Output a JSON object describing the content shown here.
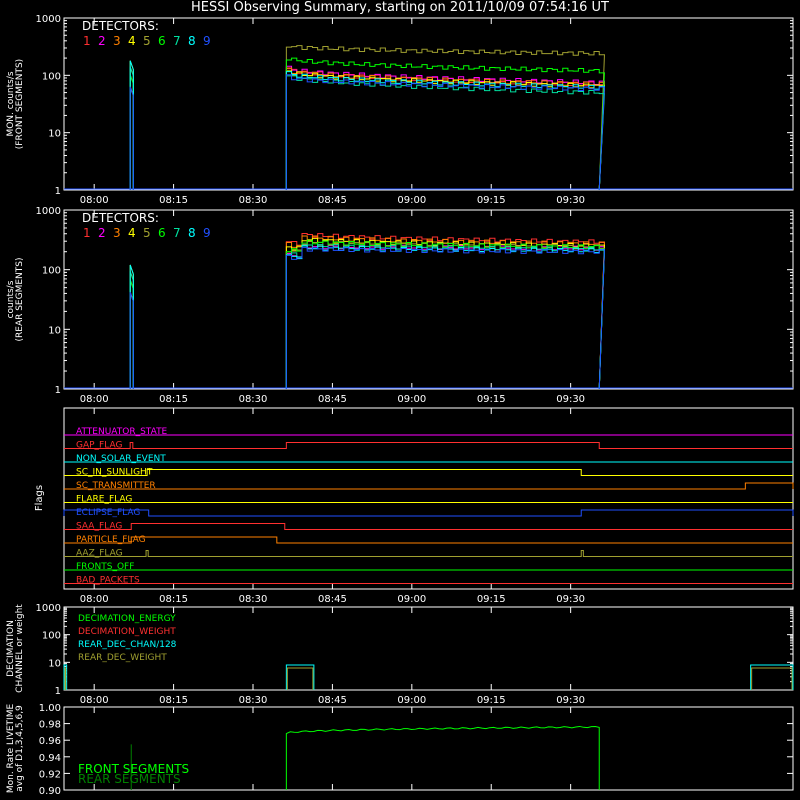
{
  "title": "HESSI Observing Summary, starting on 2011/10/09 07:54:16 UT",
  "colors": {
    "background": "#000000",
    "axes": "#ffffff",
    "det1": "#ff3030",
    "det2": "#ff00ff",
    "det3": "#ff8000",
    "det4": "#ffff00",
    "det5": "#a0a030",
    "det6": "#00ff00",
    "det7": "#00e0a0",
    "det8": "#00ffff",
    "det9": "#2050ff"
  },
  "time_ticks": [
    "08:00",
    "08:15",
    "08:30",
    "08:45",
    "09:00",
    "09:15",
    "09:30"
  ],
  "chart_data": [
    {
      "type": "line",
      "id": "front",
      "ylabel_lines": [
        "MON. counts/s",
        "(FRONT SEGMENTS)"
      ],
      "yscale": "log",
      "ylim": [
        1,
        1000
      ],
      "ytick_labels": [
        "1000",
        "100",
        "10",
        "1"
      ],
      "legend_title": "DETECTORS:",
      "legend_digits": [
        "1",
        "2",
        "3",
        "4",
        "5",
        "6",
        "7",
        "8",
        "9"
      ],
      "x_unit": "UT minutes since 08:00",
      "xlim": [
        -5.7,
        37.5
      ],
      "spike": {
        "start": 6.8,
        "end": 7.4,
        "peak": 180
      },
      "orbit": {
        "start": 36.3,
        "end": 95.4
      },
      "series": [
        {
          "name": "1",
          "color": "#ff3030",
          "start": 130,
          "end": 70
        },
        {
          "name": "2",
          "color": "#ff00ff",
          "start": 135,
          "end": 75
        },
        {
          "name": "3",
          "color": "#ff8000",
          "start": 125,
          "end": 70
        },
        {
          "name": "4",
          "color": "#ffff00",
          "start": 118,
          "end": 65
        },
        {
          "name": "5",
          "color": "#a0a030",
          "start": 330,
          "end": 240
        },
        {
          "name": "6",
          "color": "#00ff00",
          "start": 200,
          "end": 120
        },
        {
          "name": "7",
          "color": "#00e0a0",
          "start": 100,
          "end": 50
        },
        {
          "name": "8",
          "color": "#00ffff",
          "start": 110,
          "end": 62
        },
        {
          "name": "9",
          "color": "#2050ff",
          "start": 95,
          "end": 58
        }
      ]
    },
    {
      "type": "line",
      "id": "rear",
      "ylabel_lines": [
        "counts/s",
        "(REAR SEGMENTS)"
      ],
      "yscale": "log",
      "ylim": [
        1,
        1000
      ],
      "ytick_labels": [
        "1000",
        "100",
        "10",
        "1"
      ],
      "legend_title": "DETECTORS:",
      "legend_digits": [
        "1",
        "2",
        "3",
        "4",
        "5",
        "6",
        "7",
        "8",
        "9"
      ],
      "spike": {
        "start": 6.8,
        "end": 7.4,
        "peak": 120
      },
      "orbit": {
        "start": 36.3,
        "end": 95.4
      },
      "series": [
        {
          "name": "1",
          "color": "#ff3030",
          "start": 420,
          "end": 290
        },
        {
          "name": "2",
          "color": "#ff00ff",
          "start": 250,
          "end": 230
        },
        {
          "name": "3",
          "color": "#ff8000",
          "start": 380,
          "end": 270
        },
        {
          "name": "4",
          "color": "#ffff00",
          "start": 340,
          "end": 250
        },
        {
          "name": "5",
          "color": "#a0a030",
          "start": 300,
          "end": 240
        },
        {
          "name": "6",
          "color": "#00ff00",
          "start": 310,
          "end": 240
        },
        {
          "name": "7",
          "color": "#00e0a0",
          "start": 260,
          "end": 220
        },
        {
          "name": "8",
          "color": "#00ffff",
          "start": 240,
          "end": 210
        },
        {
          "name": "9",
          "color": "#2050ff",
          "start": 230,
          "end": 200
        }
      ]
    },
    {
      "type": "line",
      "id": "flags",
      "ylabel": "Flags",
      "flags": [
        {
          "name": "ATTENUATOR_STATE",
          "color": "#ff00ff",
          "segments": []
        },
        {
          "name": "GAP_FLAG",
          "color": "#ff3030",
          "segments": [
            [
              6.8,
              7.3
            ],
            [
              36.3,
              95.4
            ]
          ],
          "blips_only_first": true
        },
        {
          "name": "NON_SOLAR_EVENT",
          "color": "#00ffff",
          "segments": []
        },
        {
          "name": "SC_IN_SUNLIGHT",
          "color": "#ffff00",
          "segments": [
            [
              10.0,
              92.0
            ]
          ]
        },
        {
          "name": "SC_TRANSMITTER",
          "color": "#ff8000",
          "segments": [
            [
              123.0,
              137.0
            ]
          ]
        },
        {
          "name": "FLARE_FLAG",
          "color": "#ffff00",
          "segments": []
        },
        {
          "name": "ECLIPSE_FLAG",
          "color": "#2050ff",
          "segments": [
            [
              -5.7,
              10.3
            ],
            [
              92.0,
              137.0
            ]
          ]
        },
        {
          "name": "SAA_FLAG",
          "color": "#ff3030",
          "segments": [
            [
              7.0,
              36.0
            ]
          ]
        },
        {
          "name": "PARTICLE_FLAG",
          "color": "#ff8000",
          "segments": [
            [
              7.0,
              34.5
            ]
          ]
        },
        {
          "name": "AAZ_FLAG",
          "color": "#a0a030",
          "segments": [
            [
              9.8,
              10.2
            ],
            [
              92.0,
              92.4
            ]
          ]
        },
        {
          "name": "FRONTS_OFF",
          "color": "#00ff00",
          "segments": []
        },
        {
          "name": "BAD_PACKETS",
          "color": "#ff3030",
          "segments": []
        }
      ]
    },
    {
      "type": "line",
      "id": "decimation",
      "ylabel_lines": [
        "DECIMATION",
        "CHANNEL or weight"
      ],
      "yscale": "log",
      "ylim": [
        1,
        1000
      ],
      "ytick_labels": [
        "1000",
        "100",
        "10",
        "1"
      ],
      "series": [
        {
          "name": "DECIMATION_ENERGY",
          "color": "#00ff00"
        },
        {
          "name": "DECIMATION_WEIGHT",
          "color": "#ff3030"
        },
        {
          "name": "REAR_DEC_CHAN/128",
          "color": "#00ffff"
        },
        {
          "name": "REAR_DEC_WEIGHT",
          "color": "#a0a030"
        }
      ],
      "blocks": [
        {
          "start": -5.7,
          "end": -5.2,
          "value": 8
        },
        {
          "start": 36.3,
          "end": 41.5,
          "value": 8
        },
        {
          "start": 124.0,
          "end": 135.0,
          "value": 8
        }
      ]
    },
    {
      "type": "line",
      "id": "livetime",
      "ylabel_lines": [
        "Mon. Rate LIVETIME",
        "avg of D1,3,4,5,6,9"
      ],
      "ylim": [
        0.9,
        1.0
      ],
      "ytick_labels": [
        "1.00",
        "0.98",
        "0.96",
        "0.94",
        "0.92",
        "0.90"
      ],
      "series": [
        {
          "name": "FRONT SEGMENTS",
          "color": "#00ff00",
          "start": 0.968,
          "end": 0.976
        },
        {
          "name": "REAR SEGMENTS",
          "color": "#008000"
        }
      ],
      "spike": {
        "at": 7.0,
        "low": 0.9,
        "high": 0.955
      },
      "orbit": {
        "start": 36.3,
        "end": 95.4
      }
    }
  ]
}
